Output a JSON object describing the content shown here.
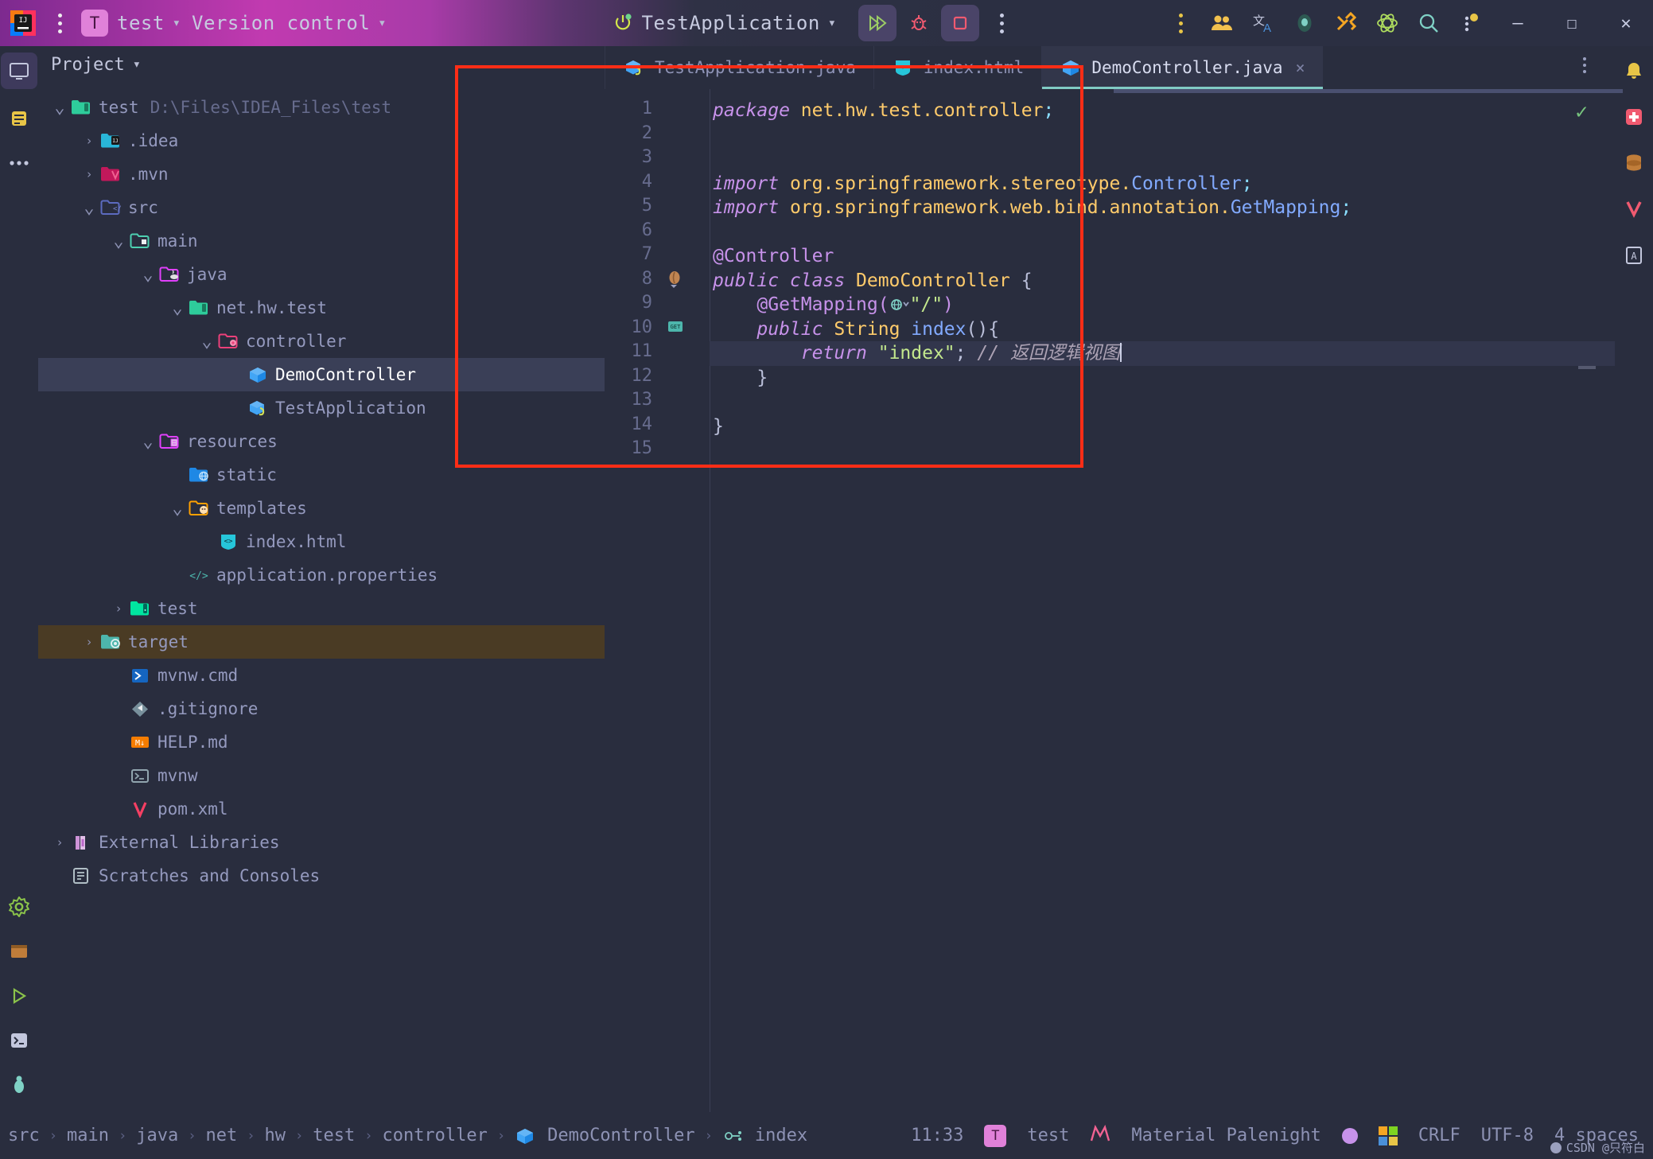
{
  "titlebar": {
    "menu_icon": "kebab-menu-icon",
    "project_initial": "T",
    "project_name": "test",
    "vcs_label": "Version control",
    "run_config": "TestApplication",
    "buttons": {
      "run": "run-icon",
      "debug": "debug-icon",
      "stop": "stop-icon",
      "more": "more-icon"
    },
    "right_icons": [
      "users-icon",
      "translate-icon",
      "ai-assistant-icon",
      "tools-icon",
      "atom-icon",
      "search-icon",
      "updates-icon"
    ],
    "window_controls": {
      "minimize": "–",
      "maximize": "☐",
      "close": "✕"
    }
  },
  "left_rail": {
    "icons": [
      "project-view-icon",
      "commit-icon",
      "more-tool-windows-icon",
      "settings-icon",
      "terminal-panel-icon",
      "run-panel-icon",
      "terminal-icon",
      "debug-panel-icon",
      "branch-icon"
    ]
  },
  "right_rail": {
    "icons": [
      "notifications-icon",
      "plugins-icon",
      "database-icon",
      "maven-icon",
      "bookmark-icon"
    ]
  },
  "project_panel": {
    "title": "Project",
    "tree": [
      {
        "label": "test",
        "path": "D:\\Files\\IDEA_Files\\test",
        "indent": 0,
        "twist": "down",
        "icon": "project-folder-icon",
        "state": "normal"
      },
      {
        "label": ".idea",
        "path": "",
        "indent": 1,
        "twist": "right",
        "icon": "idea-folder-icon",
        "state": "normal"
      },
      {
        "label": ".mvn",
        "path": "",
        "indent": 1,
        "twist": "right",
        "icon": "maven-folder-icon",
        "state": "normal"
      },
      {
        "label": "src",
        "path": "",
        "indent": 1,
        "twist": "down",
        "icon": "source-folder-icon",
        "state": "normal"
      },
      {
        "label": "main",
        "path": "",
        "indent": 2,
        "twist": "down",
        "icon": "folder-icon",
        "state": "normal"
      },
      {
        "label": "java",
        "path": "",
        "indent": 3,
        "twist": "down",
        "icon": "java-source-folder-icon",
        "state": "normal"
      },
      {
        "label": "net.hw.test",
        "path": "",
        "indent": 4,
        "twist": "down",
        "icon": "package-folder-icon",
        "state": "normal"
      },
      {
        "label": "controller",
        "path": "",
        "indent": 5,
        "twist": "down",
        "icon": "controller-folder-icon",
        "state": "normal"
      },
      {
        "label": "DemoController",
        "path": "",
        "indent": 6,
        "twist": "none",
        "icon": "java-class-icon",
        "state": "selected"
      },
      {
        "label": "TestApplication",
        "path": "",
        "indent": 6,
        "twist": "none",
        "icon": "spring-boot-class-icon",
        "state": "normal"
      },
      {
        "label": "resources",
        "path": "",
        "indent": 3,
        "twist": "down",
        "icon": "resources-folder-icon",
        "state": "normal"
      },
      {
        "label": "static",
        "path": "",
        "indent": 4,
        "twist": "none",
        "icon": "static-folder-icon",
        "state": "normal"
      },
      {
        "label": "templates",
        "path": "",
        "indent": 4,
        "twist": "down",
        "icon": "templates-folder-icon",
        "state": "normal"
      },
      {
        "label": "index.html",
        "path": "",
        "indent": 5,
        "twist": "none",
        "icon": "html-file-icon",
        "state": "normal"
      },
      {
        "label": "application.properties",
        "path": "",
        "indent": 4,
        "twist": "none",
        "icon": "properties-file-icon",
        "state": "normal"
      },
      {
        "label": "test",
        "path": "",
        "indent": 2,
        "twist": "right",
        "icon": "test-folder-icon",
        "state": "normal"
      },
      {
        "label": "target",
        "path": "",
        "indent": 1,
        "twist": "right",
        "icon": "target-folder-icon",
        "state": "highlight"
      },
      {
        "label": "mvnw.cmd",
        "path": "",
        "indent": 2,
        "twist": "none",
        "icon": "cmd-file-icon",
        "state": "normal"
      },
      {
        "label": ".gitignore",
        "path": "",
        "indent": 2,
        "twist": "none",
        "icon": "git-file-icon",
        "state": "normal"
      },
      {
        "label": "HELP.md",
        "path": "",
        "indent": 2,
        "twist": "none",
        "icon": "markdown-file-icon",
        "state": "normal"
      },
      {
        "label": "mvnw",
        "path": "",
        "indent": 2,
        "twist": "none",
        "icon": "shell-file-icon",
        "state": "normal"
      },
      {
        "label": "pom.xml",
        "path": "",
        "indent": 2,
        "twist": "none",
        "icon": "maven-pom-icon",
        "state": "normal"
      },
      {
        "label": "External Libraries",
        "path": "",
        "indent": 0,
        "twist": "right",
        "icon": "libraries-icon",
        "state": "normal"
      },
      {
        "label": "Scratches and Consoles",
        "path": "",
        "indent": 0,
        "twist": "none",
        "icon": "scratches-icon",
        "state": "normal"
      }
    ]
  },
  "editor": {
    "tabs": [
      {
        "label": "TestApplication.java",
        "icon": "spring-boot-class-icon",
        "active": false,
        "closable": false
      },
      {
        "label": "index.html",
        "icon": "html-file-icon",
        "active": false,
        "closable": false
      },
      {
        "label": "DemoController.java",
        "icon": "java-class-icon",
        "active": true,
        "closable": true
      }
    ],
    "tab_close_glyph": "×",
    "inspection_status": "✓",
    "line_count": 15,
    "gutter_marks": {
      "8": "spring-bean-icon",
      "10": "web-mapping-icon"
    },
    "current_line": 11,
    "lines": [
      {
        "n": 1,
        "tokens": [
          {
            "t": "package ",
            "c": "k-kw"
          },
          {
            "t": "net.hw.test.controller",
            "c": "k-pkg"
          },
          {
            "t": ";",
            "c": "k-punc"
          }
        ]
      },
      {
        "n": 2,
        "tokens": []
      },
      {
        "n": 3,
        "tokens": []
      },
      {
        "n": 4,
        "tokens": [
          {
            "t": "import ",
            "c": "k-kw"
          },
          {
            "t": "org.springframework.stereotype.",
            "c": "k-pkg"
          },
          {
            "t": "Controller",
            "c": "k-meth"
          },
          {
            "t": ";",
            "c": "k-punc"
          }
        ]
      },
      {
        "n": 5,
        "tokens": [
          {
            "t": "import ",
            "c": "k-kw"
          },
          {
            "t": "org.springframework.web.bind.annotation.",
            "c": "k-pkg"
          },
          {
            "t": "GetMapping",
            "c": "k-meth"
          },
          {
            "t": ";",
            "c": "k-punc"
          }
        ]
      },
      {
        "n": 6,
        "tokens": []
      },
      {
        "n": 7,
        "tokens": [
          {
            "t": "@Controller",
            "c": "k-ann"
          }
        ]
      },
      {
        "n": 8,
        "tokens": [
          {
            "t": "public class ",
            "c": "k-kw"
          },
          {
            "t": "DemoController",
            "c": "k-cls"
          },
          {
            "t": " {",
            "c": "k-plain"
          }
        ]
      },
      {
        "n": 9,
        "tokens": [
          {
            "t": "    @GetMapping(",
            "c": "k-ann"
          },
          {
            "t": "GLOBE",
            "c": "icon"
          },
          {
            "t": "\"/\"",
            "c": "k-str"
          },
          {
            "t": ")",
            "c": "k-ann"
          }
        ]
      },
      {
        "n": 10,
        "tokens": [
          {
            "t": "    public ",
            "c": "k-kw"
          },
          {
            "t": "String ",
            "c": "k-cls"
          },
          {
            "t": "index",
            "c": "k-meth"
          },
          {
            "t": "(){",
            "c": "k-plain"
          }
        ]
      },
      {
        "n": 11,
        "tokens": [
          {
            "t": "        return ",
            "c": "k-kw"
          },
          {
            "t": "\"index\"",
            "c": "k-str"
          },
          {
            "t": "; ",
            "c": "k-plain"
          },
          {
            "t": "// 返回逻辑视图",
            "c": "k-cmt"
          },
          {
            "t": "CARET",
            "c": "caret"
          }
        ]
      },
      {
        "n": 12,
        "tokens": [
          {
            "t": "    }",
            "c": "k-plain"
          }
        ]
      },
      {
        "n": 13,
        "tokens": []
      },
      {
        "n": 14,
        "tokens": [
          {
            "t": "}",
            "c": "k-plain"
          }
        ]
      },
      {
        "n": 15,
        "tokens": []
      }
    ]
  },
  "annotation": {
    "type": "red-rectangle-highlight",
    "color": "#FF2D16"
  },
  "statusbar": {
    "breadcrumb": [
      {
        "label": "src",
        "icon": ""
      },
      {
        "label": "main",
        "icon": ""
      },
      {
        "label": "java",
        "icon": ""
      },
      {
        "label": "net",
        "icon": ""
      },
      {
        "label": "hw",
        "icon": ""
      },
      {
        "label": "test",
        "icon": ""
      },
      {
        "label": "controller",
        "icon": ""
      },
      {
        "label": "DemoController",
        "icon": "java-class-icon"
      },
      {
        "label": "index",
        "icon": "web-mapping-icon"
      }
    ],
    "separator": "›",
    "caret_position": "11:33",
    "project_initial": "T",
    "project_name": "test",
    "theme_icon": "material-theme-icon",
    "theme_name": "Material Palenight",
    "color_dot": "#C792EA",
    "os_icon": "windows-icon",
    "line_separator": "CRLF",
    "encoding": "UTF-8",
    "indent": "4 spaces",
    "watermark": "CSDN @只符白"
  },
  "colors": {
    "background": "#292D3E",
    "accent": "#80CBC4",
    "selection": "#3A3F57",
    "highlight_row": "#4A3B24",
    "annotation_red": "#FF2D16",
    "keyword": "#C792EA",
    "string": "#C3E88D",
    "class": "#FFCB6B",
    "method": "#82AAFF",
    "comment": "#ADA3B5"
  }
}
